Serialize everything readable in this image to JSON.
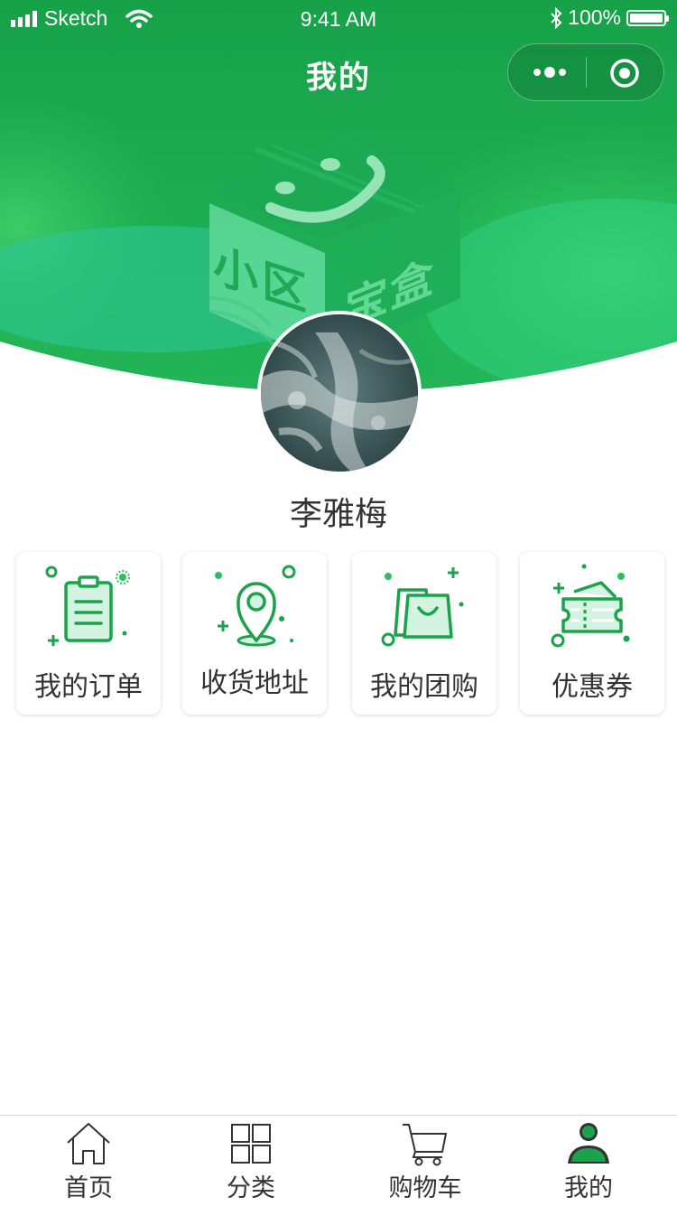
{
  "status_bar": {
    "carrier": "Sketch",
    "time": "9:41 AM",
    "battery": "100%"
  },
  "nav": {
    "title": "我的"
  },
  "hero": {
    "logo_text_left": "小区",
    "logo_text_right": "宝盒"
  },
  "user": {
    "name": "李雅梅"
  },
  "menu": {
    "items": [
      {
        "label": "我的订单",
        "icon": "clipboard-icon"
      },
      {
        "label": "收货地址",
        "icon": "location-pin-icon"
      },
      {
        "label": "我的团购",
        "icon": "shopping-bag-icon"
      },
      {
        "label": "优惠券",
        "icon": "coupon-icon"
      }
    ]
  },
  "tabbar": {
    "items": [
      {
        "label": "首页",
        "icon": "home-icon",
        "active": false
      },
      {
        "label": "分类",
        "icon": "grid-icon",
        "active": false
      },
      {
        "label": "购物车",
        "icon": "cart-icon",
        "active": false
      },
      {
        "label": "我的",
        "icon": "user-icon",
        "active": true
      }
    ]
  },
  "colors": {
    "brand_green": "#1aa34a",
    "brand_green_light": "#2bc25e",
    "accent_teal": "#2fc9a0",
    "text_dark": "#333333",
    "tab_active": "#1aa34a"
  }
}
